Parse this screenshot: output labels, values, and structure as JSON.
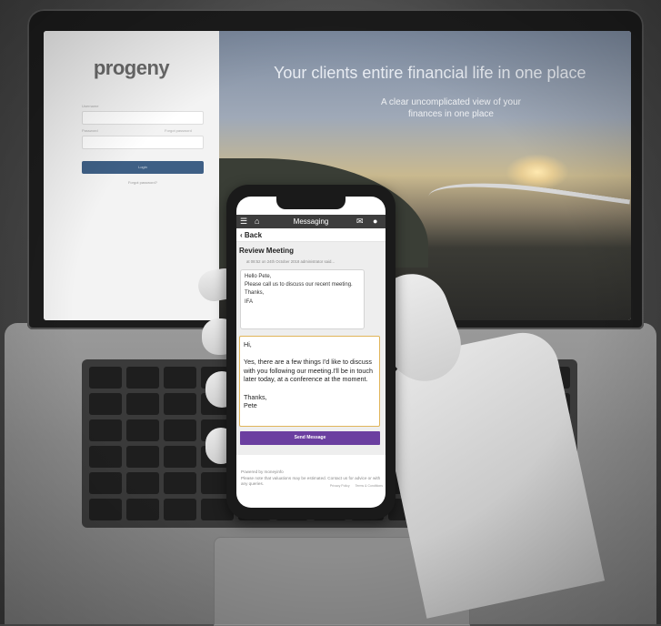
{
  "laptop": {
    "logo": "progeny",
    "username_label": "Username",
    "password_label": "Password",
    "forgot_label": "Forgot password",
    "login_button": "Login",
    "forgot_link": "Forgot password?",
    "hero_title": "Your clients entire financial life in one place",
    "hero_subtitle": "A clear uncomplicated view of your finances in one place"
  },
  "phone": {
    "header_title": "Messaging",
    "menu_icon": "menu-icon",
    "home_icon": "home-icon",
    "mail_icon": "mail-icon",
    "user_icon": "user-icon",
    "back_label": "Back",
    "subject": "Review Meeting",
    "meta": "at 08:52 on 24th October 2018 administrator said...",
    "message_lines": [
      "Hello Pete,",
      "Please call us to discuss our recent meeting.",
      "Thanks,",
      "IFA"
    ],
    "reply_lines": [
      "Hi,",
      "",
      "Yes, there are a few things I'd like to discuss with you following our meeting.I'll be in touch later today, at a conference at the moment.",
      "",
      "Thanks,",
      "Pete"
    ],
    "send_button": "Send Message",
    "powered_by": "Powered by moneyinfo",
    "disclaimer": "Please note that valuations may be estimated. Contact us for advice or with any queries.",
    "privacy_link": "Privacy Policy",
    "terms_link": "Terms & Conditions",
    "accent_color": "#6b3fa0"
  }
}
